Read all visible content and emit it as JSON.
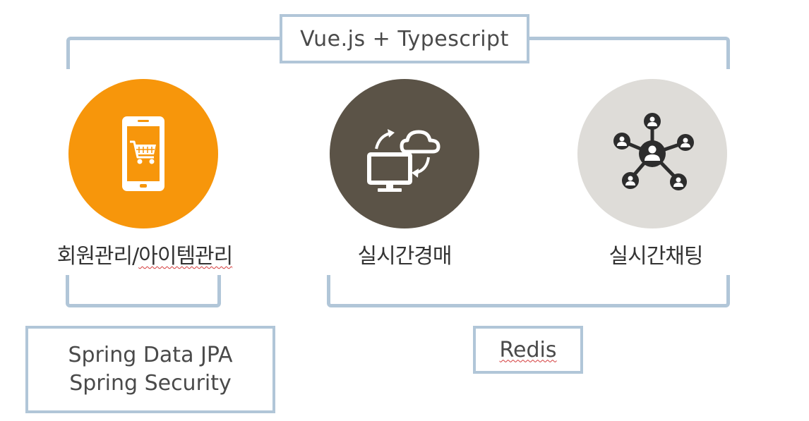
{
  "top_group": {
    "label": "Vue.js + Typescript"
  },
  "features": [
    {
      "caption_a": "회원관리/",
      "caption_b": "아이템관리",
      "icon": "shopping-cart-phone-icon",
      "color": "#f7960b"
    },
    {
      "caption": "실시간경매",
      "icon": "cloud-sync-monitor-icon",
      "color": "#5b5347"
    },
    {
      "caption": "실시간채팅",
      "icon": "people-network-icon",
      "color": "#dedcd8"
    }
  ],
  "bottom_groups": [
    {
      "lines": [
        "Spring Data JPA",
        "Spring Security"
      ]
    },
    {
      "label": "Redis"
    }
  ],
  "colors": {
    "bracket": "#b1c6d8",
    "text": "#4a4a4a"
  }
}
